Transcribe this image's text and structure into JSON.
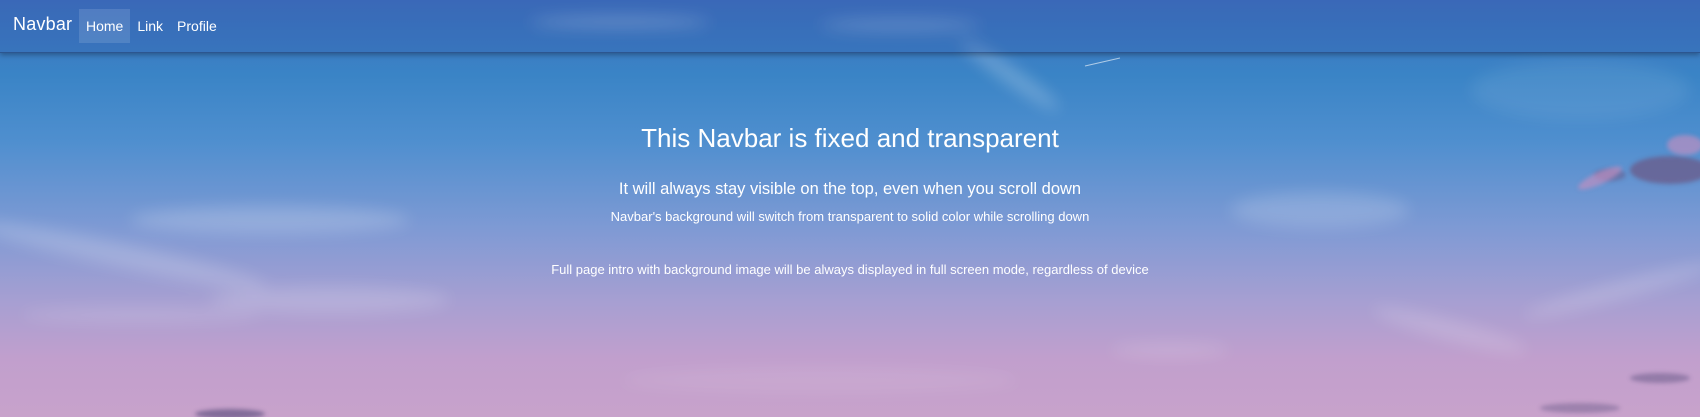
{
  "navbar": {
    "brand": "Navbar",
    "links": [
      {
        "label": "Home",
        "active": true
      },
      {
        "label": "Link",
        "active": false
      },
      {
        "label": "Profile",
        "active": false
      }
    ]
  },
  "intro": {
    "title": "This Navbar is fixed and transparent",
    "subtitle": "It will always stay visible on the top, even when you scroll down",
    "subtitle_small": "Navbar's background will switch from transparent to solid color while scrolling down",
    "description": "Full page intro with background image will be always displayed in full screen mode, regardless of device"
  },
  "background": {
    "description_icon": "sky-background-image",
    "colors": {
      "sky_top": "#3f6fbe",
      "sky_mid": "#4f8fcf",
      "sky_bottom": "#c8a2cb",
      "text": "#ffffff"
    }
  }
}
